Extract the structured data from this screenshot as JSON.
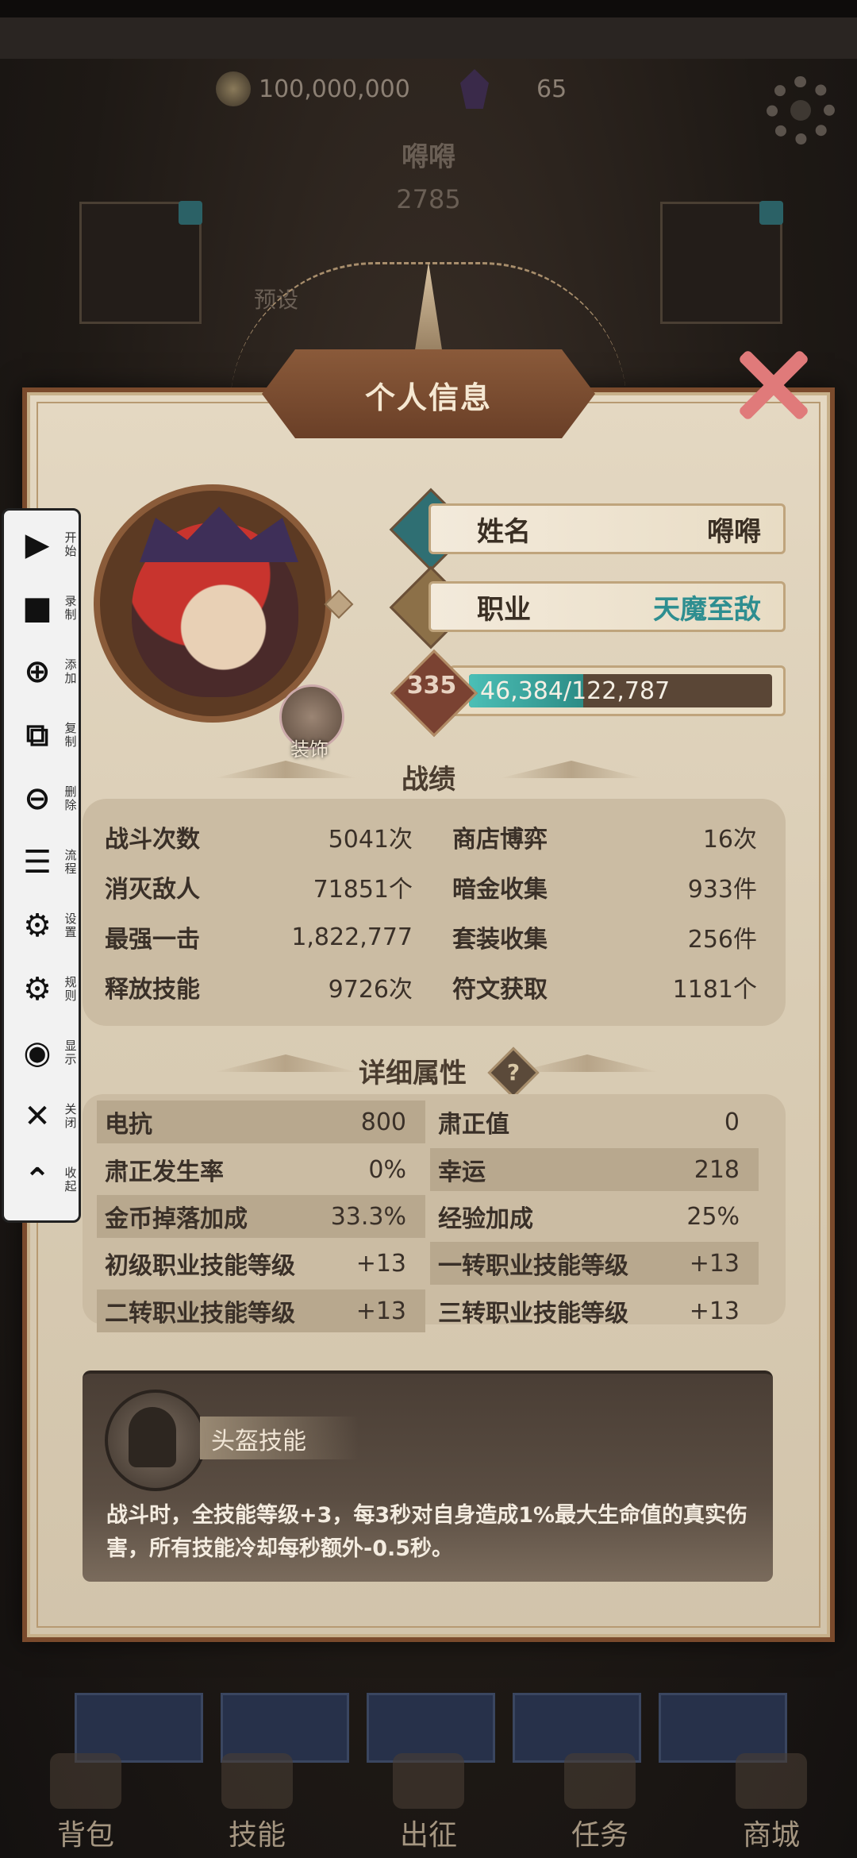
{
  "resources": {
    "gold": "100,000,000",
    "gems": "65"
  },
  "background": {
    "player_name": "嘚嘚",
    "power": "2785",
    "preset_label": "预设"
  },
  "panel": {
    "title": "个人信息"
  },
  "profile": {
    "decoration_label": "装饰",
    "name_label": "姓名",
    "name_value": "嘚嘚",
    "job_label": "职业",
    "job_value": "天魔至敌",
    "level": "335",
    "xp_current": "46,384",
    "xp_separator": "/",
    "xp_max": "122,787",
    "xp_fraction": 0.3778
  },
  "record": {
    "title": "战绩",
    "items": [
      {
        "label": "战斗次数",
        "value": "5041次"
      },
      {
        "label": "商店博弈",
        "value": "16次"
      },
      {
        "label": "消灭敌人",
        "value": "71851个"
      },
      {
        "label": "暗金收集",
        "value": "933件"
      },
      {
        "label": "最强一击",
        "value": "1,822,777"
      },
      {
        "label": "套装收集",
        "value": "256件"
      },
      {
        "label": "释放技能",
        "value": "9726次"
      },
      {
        "label": "符文获取",
        "value": "1181个"
      }
    ]
  },
  "attributes": {
    "title": "详细属性",
    "help": "?",
    "items": [
      {
        "label": "电抗",
        "value": "800"
      },
      {
        "label": "肃正值",
        "value": "0"
      },
      {
        "label": "肃正发生率",
        "value": "0%"
      },
      {
        "label": "幸运",
        "value": "218"
      },
      {
        "label": "金币掉落加成",
        "value": "33.3%"
      },
      {
        "label": "经验加成",
        "value": "25%"
      },
      {
        "label": "初级职业技能等级",
        "value": "+13"
      },
      {
        "label": "一转职业技能等级",
        "value": "+13"
      },
      {
        "label": "二转职业技能等级",
        "value": "+13"
      },
      {
        "label": "三转职业技能等级",
        "value": "+13"
      }
    ]
  },
  "skill": {
    "name": "头盔技能",
    "description": "战斗时，全技能等级+3，每3秒对自身造成1%最大生命值的真实伤害，所有技能冷却每秒额外-0.5秒。"
  },
  "nav": [
    {
      "label": "背包"
    },
    {
      "label": "技能"
    },
    {
      "label": "出征"
    },
    {
      "label": "任务"
    },
    {
      "label": "商城"
    }
  ],
  "toolbar": [
    {
      "icon": "play-icon",
      "glyph": "▶",
      "label": "开始"
    },
    {
      "icon": "record-icon",
      "glyph": "■",
      "label": "录制"
    },
    {
      "icon": "add-icon",
      "glyph": "⊕",
      "label": "添加"
    },
    {
      "icon": "copy-icon",
      "glyph": "⧉",
      "label": "复制"
    },
    {
      "icon": "delete-icon",
      "glyph": "⊖",
      "label": "删除"
    },
    {
      "icon": "flow-icon",
      "glyph": "☰",
      "label": "流程"
    },
    {
      "icon": "settings-icon",
      "glyph": "⚙",
      "label": "设置"
    },
    {
      "icon": "rules-icon",
      "glyph": "⚙",
      "label": "规则"
    },
    {
      "icon": "eye-icon",
      "glyph": "◉",
      "label": "显示"
    },
    {
      "icon": "close-icon",
      "glyph": "✕",
      "label": "关闭"
    },
    {
      "icon": "collapse-icon",
      "glyph": "⌃",
      "label": "收起"
    }
  ],
  "colors": {
    "accent_teal": "#2e8e90",
    "panel_border": "#7a4a2c",
    "close_pink": "#e07a7a"
  }
}
